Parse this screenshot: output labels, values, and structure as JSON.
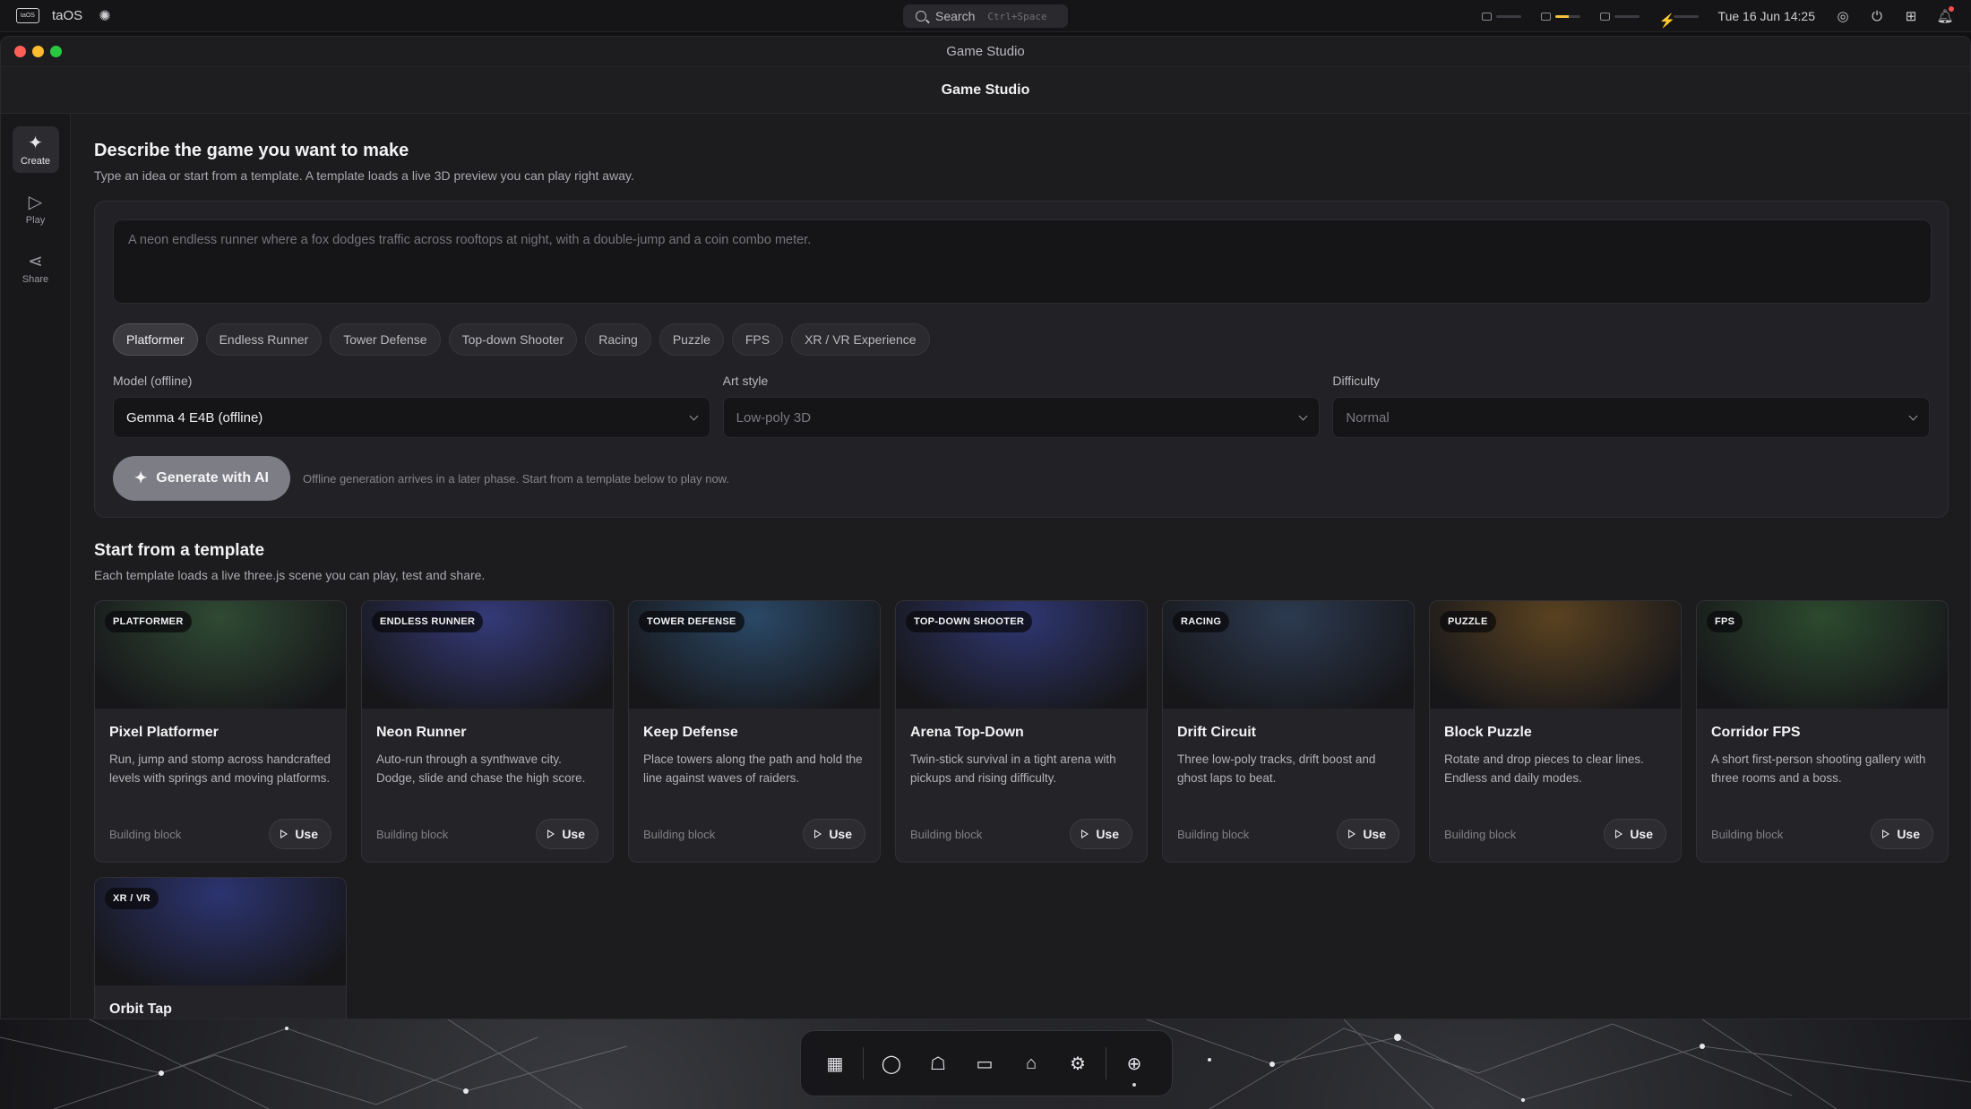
{
  "system": {
    "app_name": "taOS",
    "logo_text": "taOS",
    "search_label": "Search",
    "search_shortcut": "Ctrl+Space",
    "meters": [
      {
        "icon": "cpu-icon",
        "level": 0.0
      },
      {
        "icon": "memory-icon",
        "level": 0.55
      },
      {
        "icon": "disk-icon",
        "level": 0.0
      },
      {
        "icon": "power-icon",
        "level": 0.0
      }
    ],
    "accent_color": "#f2c23a",
    "datetime": "Tue 16 Jun 14:25"
  },
  "window": {
    "title": "Game Studio",
    "header_title": "Game Studio"
  },
  "sidebar": {
    "items": [
      {
        "label": "Create",
        "icon": "sparkle-icon",
        "glyph": "✦",
        "active": true
      },
      {
        "label": "Play",
        "icon": "play-icon",
        "glyph": "▷",
        "active": false
      },
      {
        "label": "Share",
        "icon": "share-icon",
        "glyph": "⋖",
        "active": false
      }
    ]
  },
  "create": {
    "heading": "Describe the game you want to make",
    "subtext": "Type an idea or start from a template. A template loads a live 3D preview you can play right away.",
    "prompt_placeholder": "A neon endless runner where a fox dodges traffic across rooftops at night, with a double-jump and a coin combo meter.",
    "genres": [
      "Platformer",
      "Endless Runner",
      "Tower Defense",
      "Top-down Shooter",
      "Racing",
      "Puzzle",
      "FPS",
      "XR / VR Experience"
    ],
    "selected_genre": "Platformer",
    "fields": {
      "model": {
        "label": "Model (offline)",
        "value": "Gemma 4 E4B (offline)"
      },
      "art_style": {
        "label": "Art style",
        "value": "Low-poly 3D"
      },
      "difficulty": {
        "label": "Difficulty",
        "value": "Normal"
      }
    },
    "generate_label": "Generate with AI",
    "generate_note": "Offline generation arrives in a later phase. Start from a template below to play now."
  },
  "templates": {
    "heading": "Start from a template",
    "subtext": "Each template loads a live three.js scene you can play, test and share.",
    "use_label": "Use",
    "items": [
      {
        "tag": "PLATFORMER",
        "title": "Pixel Platformer",
        "desc": "Run, jump and stomp across handcrafted levels with springs and moving platforms.",
        "kind": "Building block",
        "color": "#2f4a33"
      },
      {
        "tag": "ENDLESS RUNNER",
        "title": "Neon Runner",
        "desc": "Auto-run through a synthwave city. Dodge, slide and chase the high score.",
        "kind": "Building block",
        "color": "#343a78"
      },
      {
        "tag": "TOWER DEFENSE",
        "title": "Keep Defense",
        "desc": "Place towers along the path and hold the line against waves of raiders.",
        "kind": "Building block",
        "color": "#2a4866"
      },
      {
        "tag": "TOP-DOWN SHOOTER",
        "title": "Arena Top-Down",
        "desc": "Twin-stick survival in a tight arena with pickups and rising difficulty.",
        "kind": "Building block",
        "color": "#2f3772"
      },
      {
        "tag": "RACING",
        "title": "Drift Circuit",
        "desc": "Three low-poly tracks, drift boost and ghost laps to beat.",
        "kind": "Building block",
        "color": "#2c3a50"
      },
      {
        "tag": "PUZZLE",
        "title": "Block Puzzle",
        "desc": "Rotate and drop pieces to clear lines. Endless and daily modes.",
        "kind": "Building block",
        "color": "#5a4220"
      },
      {
        "tag": "FPS",
        "title": "Corridor FPS",
        "desc": "A short first-person shooting gallery with three rooms and a boss.",
        "kind": "Building block",
        "color": "#2c4a2e"
      },
      {
        "tag": "XR / VR",
        "title": "Orbit Tap",
        "desc": "",
        "kind": "",
        "color": "#2c3470"
      }
    ]
  },
  "dock": {
    "items": [
      {
        "icon": "apps-grid-icon",
        "glyph": "▦"
      },
      {
        "icon": "chat-icon",
        "glyph": "◯"
      },
      {
        "icon": "robot-icon",
        "glyph": "☖"
      },
      {
        "icon": "folder-icon",
        "glyph": "▭"
      },
      {
        "icon": "store-bag-icon",
        "glyph": "⌂"
      },
      {
        "icon": "settings-gear-icon",
        "glyph": "⚙"
      },
      {
        "icon": "gamepad-icon",
        "glyph": "⊕"
      }
    ]
  }
}
